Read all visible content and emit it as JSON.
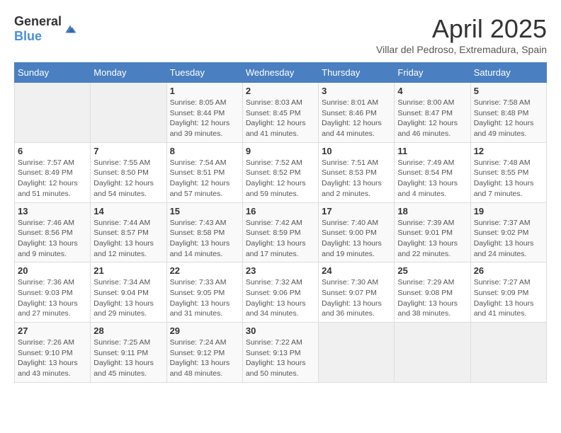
{
  "header": {
    "logo_general": "General",
    "logo_blue": "Blue",
    "title": "April 2025",
    "subtitle": "Villar del Pedroso, Extremadura, Spain"
  },
  "weekdays": [
    "Sunday",
    "Monday",
    "Tuesday",
    "Wednesday",
    "Thursday",
    "Friday",
    "Saturday"
  ],
  "weeks": [
    [
      {
        "day": "",
        "info": ""
      },
      {
        "day": "",
        "info": ""
      },
      {
        "day": "1",
        "info": "Sunrise: 8:05 AM\nSunset: 8:44 PM\nDaylight: 12 hours and 39 minutes."
      },
      {
        "day": "2",
        "info": "Sunrise: 8:03 AM\nSunset: 8:45 PM\nDaylight: 12 hours and 41 minutes."
      },
      {
        "day": "3",
        "info": "Sunrise: 8:01 AM\nSunset: 8:46 PM\nDaylight: 12 hours and 44 minutes."
      },
      {
        "day": "4",
        "info": "Sunrise: 8:00 AM\nSunset: 8:47 PM\nDaylight: 12 hours and 46 minutes."
      },
      {
        "day": "5",
        "info": "Sunrise: 7:58 AM\nSunset: 8:48 PM\nDaylight: 12 hours and 49 minutes."
      }
    ],
    [
      {
        "day": "6",
        "info": "Sunrise: 7:57 AM\nSunset: 8:49 PM\nDaylight: 12 hours and 51 minutes."
      },
      {
        "day": "7",
        "info": "Sunrise: 7:55 AM\nSunset: 8:50 PM\nDaylight: 12 hours and 54 minutes."
      },
      {
        "day": "8",
        "info": "Sunrise: 7:54 AM\nSunset: 8:51 PM\nDaylight: 12 hours and 57 minutes."
      },
      {
        "day": "9",
        "info": "Sunrise: 7:52 AM\nSunset: 8:52 PM\nDaylight: 12 hours and 59 minutes."
      },
      {
        "day": "10",
        "info": "Sunrise: 7:51 AM\nSunset: 8:53 PM\nDaylight: 13 hours and 2 minutes."
      },
      {
        "day": "11",
        "info": "Sunrise: 7:49 AM\nSunset: 8:54 PM\nDaylight: 13 hours and 4 minutes."
      },
      {
        "day": "12",
        "info": "Sunrise: 7:48 AM\nSunset: 8:55 PM\nDaylight: 13 hours and 7 minutes."
      }
    ],
    [
      {
        "day": "13",
        "info": "Sunrise: 7:46 AM\nSunset: 8:56 PM\nDaylight: 13 hours and 9 minutes."
      },
      {
        "day": "14",
        "info": "Sunrise: 7:44 AM\nSunset: 8:57 PM\nDaylight: 13 hours and 12 minutes."
      },
      {
        "day": "15",
        "info": "Sunrise: 7:43 AM\nSunset: 8:58 PM\nDaylight: 13 hours and 14 minutes."
      },
      {
        "day": "16",
        "info": "Sunrise: 7:42 AM\nSunset: 8:59 PM\nDaylight: 13 hours and 17 minutes."
      },
      {
        "day": "17",
        "info": "Sunrise: 7:40 AM\nSunset: 9:00 PM\nDaylight: 13 hours and 19 minutes."
      },
      {
        "day": "18",
        "info": "Sunrise: 7:39 AM\nSunset: 9:01 PM\nDaylight: 13 hours and 22 minutes."
      },
      {
        "day": "19",
        "info": "Sunrise: 7:37 AM\nSunset: 9:02 PM\nDaylight: 13 hours and 24 minutes."
      }
    ],
    [
      {
        "day": "20",
        "info": "Sunrise: 7:36 AM\nSunset: 9:03 PM\nDaylight: 13 hours and 27 minutes."
      },
      {
        "day": "21",
        "info": "Sunrise: 7:34 AM\nSunset: 9:04 PM\nDaylight: 13 hours and 29 minutes."
      },
      {
        "day": "22",
        "info": "Sunrise: 7:33 AM\nSunset: 9:05 PM\nDaylight: 13 hours and 31 minutes."
      },
      {
        "day": "23",
        "info": "Sunrise: 7:32 AM\nSunset: 9:06 PM\nDaylight: 13 hours and 34 minutes."
      },
      {
        "day": "24",
        "info": "Sunrise: 7:30 AM\nSunset: 9:07 PM\nDaylight: 13 hours and 36 minutes."
      },
      {
        "day": "25",
        "info": "Sunrise: 7:29 AM\nSunset: 9:08 PM\nDaylight: 13 hours and 38 minutes."
      },
      {
        "day": "26",
        "info": "Sunrise: 7:27 AM\nSunset: 9:09 PM\nDaylight: 13 hours and 41 minutes."
      }
    ],
    [
      {
        "day": "27",
        "info": "Sunrise: 7:26 AM\nSunset: 9:10 PM\nDaylight: 13 hours and 43 minutes."
      },
      {
        "day": "28",
        "info": "Sunrise: 7:25 AM\nSunset: 9:11 PM\nDaylight: 13 hours and 45 minutes."
      },
      {
        "day": "29",
        "info": "Sunrise: 7:24 AM\nSunset: 9:12 PM\nDaylight: 13 hours and 48 minutes."
      },
      {
        "day": "30",
        "info": "Sunrise: 7:22 AM\nSunset: 9:13 PM\nDaylight: 13 hours and 50 minutes."
      },
      {
        "day": "",
        "info": ""
      },
      {
        "day": "",
        "info": ""
      },
      {
        "day": "",
        "info": ""
      }
    ]
  ]
}
